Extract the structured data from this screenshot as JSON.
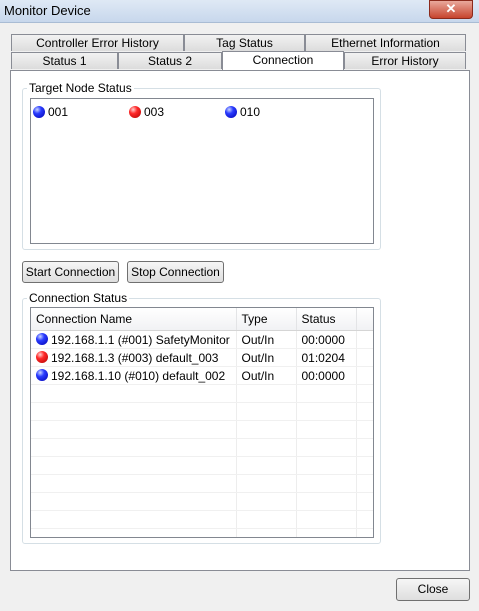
{
  "window": {
    "title": "Monitor Device",
    "close_glyph": "✕"
  },
  "tabs": {
    "row1": [
      "Controller Error History",
      "Tag Status",
      "Ethernet Information"
    ],
    "row2": [
      "Status 1",
      "Status 2",
      "Connection",
      "Error History"
    ],
    "active": "Connection"
  },
  "target_node_status": {
    "label": "Target Node Status",
    "nodes": [
      {
        "id": "001",
        "state": "blue"
      },
      {
        "id": "003",
        "state": "red"
      },
      {
        "id": "010",
        "state": "blue"
      }
    ]
  },
  "buttons": {
    "start": "Start Connection",
    "stop": "Stop Connection",
    "close": "Close"
  },
  "connection_status": {
    "label": "Connection Status",
    "columns": [
      "Connection Name",
      "Type",
      "Status"
    ],
    "rows": [
      {
        "name": "192.168.1.1 (#001) SafetyMonitor",
        "type": "Out/In",
        "status": "00:0000",
        "state": "blue"
      },
      {
        "name": "192.168.1.3 (#003) default_003",
        "type": "Out/In",
        "status": "01:0204",
        "state": "red"
      },
      {
        "name": "192.168.1.10 (#010) default_002",
        "type": "Out/In",
        "status": "00:0000",
        "state": "blue"
      }
    ]
  },
  "colors": {
    "ok": "#2a3cff",
    "error": "#ff2a2a",
    "titlebar": "#c7d7ec"
  }
}
